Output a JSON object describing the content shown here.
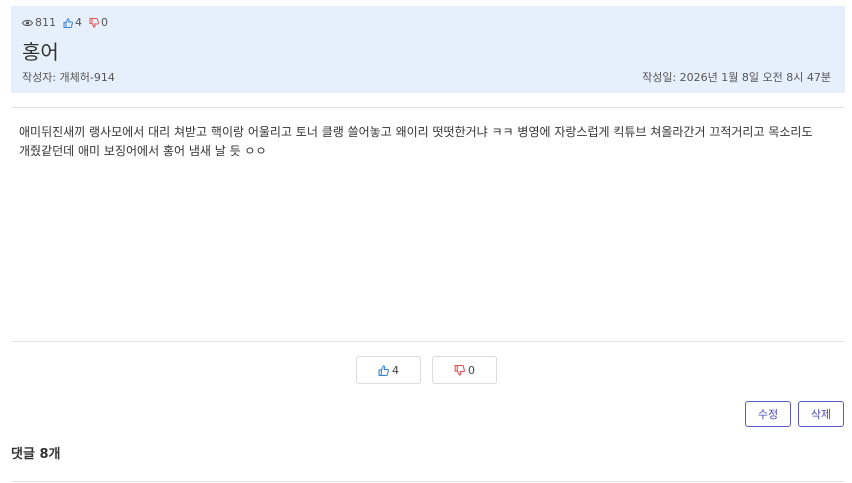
{
  "post": {
    "views": "811",
    "likes": "4",
    "dislikes": "0",
    "title": "홍어",
    "author": "작성자: 개체허-914",
    "date": "작성일: 2026년 1월 8일 오전 8시 47분",
    "content": "애미뒤진새끼 랭사모에서 대리 쳐받고 핵이랑 어울리고 토너 클랭 쓸어놓고 왜이리 떳떳한거냐 ㅋㅋ 병영에 자랑스럽게 킥튜브 쳐올라간거 끄적거리고 목소리도 개줬같던데 애미 보징어에서 홍어 냄새 날 듯 ㅇㅇ"
  },
  "vote": {
    "like_count": "4",
    "dislike_count": "0"
  },
  "actions": {
    "edit_label": "수정",
    "delete_label": "삭제"
  },
  "comments": {
    "title": "댓글 8개"
  },
  "colors": {
    "header_bg": "#e6f0fc",
    "like_blue": "#3b82d6",
    "dislike_red": "#e05555",
    "action_border": "#5c5cc7"
  },
  "icons": [
    "eye-icon",
    "thumbs-up-icon",
    "thumbs-down-icon"
  ]
}
